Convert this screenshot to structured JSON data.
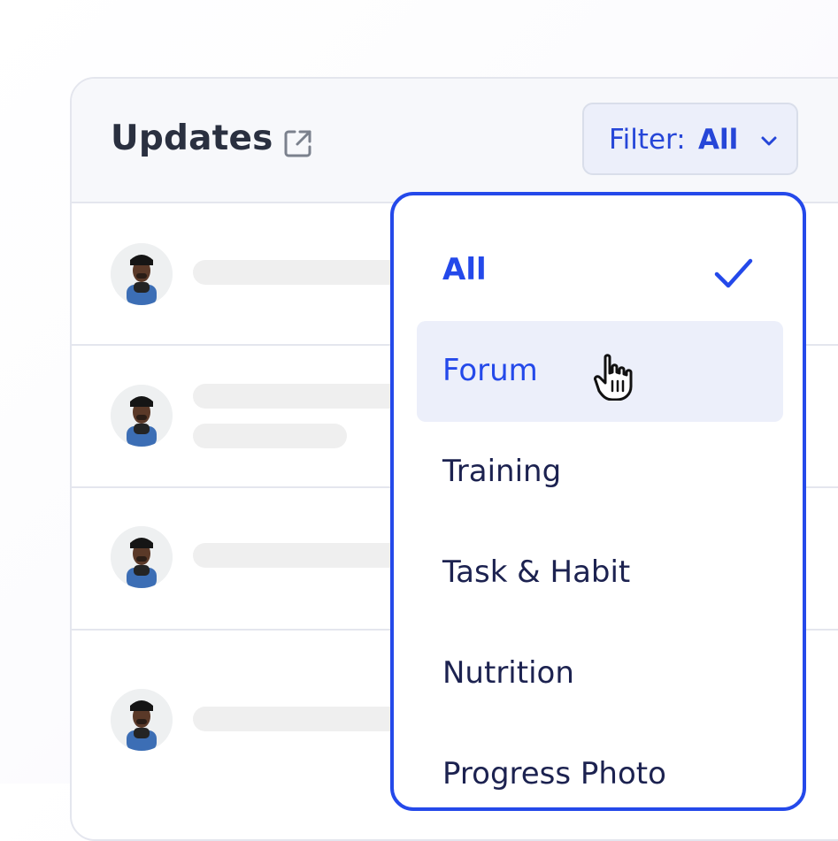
{
  "header": {
    "title": "Updates",
    "external_link_icon": "external-link-icon"
  },
  "filter": {
    "prefix": "Filter:",
    "selected": "All",
    "icon": "chevron-down-icon"
  },
  "feed": {
    "rows": [
      {
        "avatar": "avatar-photo"
      },
      {
        "avatar": "avatar-photo"
      },
      {
        "avatar": "avatar-photo"
      },
      {
        "avatar": "avatar-photo"
      }
    ]
  },
  "dropdown": {
    "options": [
      {
        "label": "All",
        "state": "selected"
      },
      {
        "label": "Forum",
        "state": "hover"
      },
      {
        "label": "Training",
        "state": "default"
      },
      {
        "label": "Task & Habit",
        "state": "default"
      },
      {
        "label": "Nutrition",
        "state": "default"
      },
      {
        "label": "Progress Photo",
        "state": "default"
      }
    ],
    "selected_icon": "check-icon",
    "cursor_icon": "hand-pointer-icon"
  },
  "colors": {
    "accent": "#2449ea",
    "text_dark": "#2a3040",
    "hover_bg": "#eceffa"
  }
}
